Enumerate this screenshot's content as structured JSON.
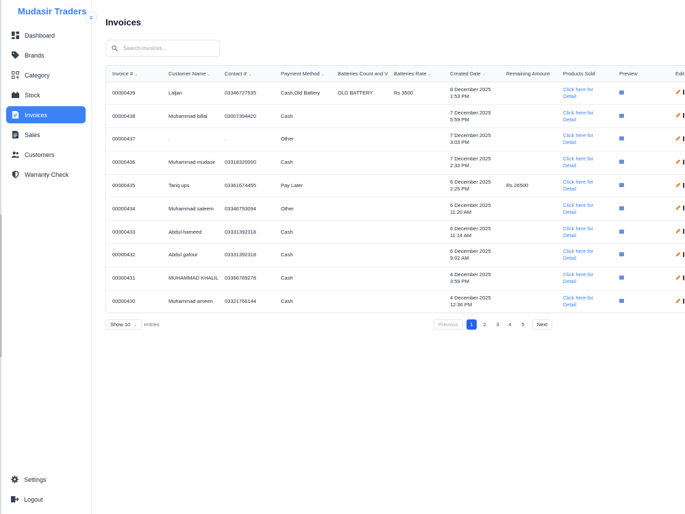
{
  "app": {
    "brand": "Mudasir Traders"
  },
  "sidebar": {
    "items": [
      {
        "label": "Dashboard",
        "icon": "dashboard-icon",
        "active": false
      },
      {
        "label": "Brands",
        "icon": "tag-icon",
        "active": false
      },
      {
        "label": "Category",
        "icon": "category-icon",
        "active": false
      },
      {
        "label": "Stock",
        "icon": "battery-icon",
        "active": false
      },
      {
        "label": "Invoices",
        "icon": "invoice-icon",
        "active": true
      },
      {
        "label": "Sales",
        "icon": "document-icon",
        "active": false
      },
      {
        "label": "Customers",
        "icon": "users-icon",
        "active": false
      },
      {
        "label": "Warranty Check",
        "icon": "shield-icon",
        "active": false
      }
    ],
    "bottom": [
      {
        "label": "Settings",
        "icon": "gear-icon"
      },
      {
        "label": "Logout",
        "icon": "logout-icon"
      }
    ],
    "collapse_icon": "collapse-sidebar-icon"
  },
  "main": {
    "title": "Invoices",
    "search": {
      "placeholder": "Search invoices...",
      "value": ""
    }
  },
  "table": {
    "columns": [
      {
        "label": "Invoice #",
        "sortable": true
      },
      {
        "label": "Customer Name",
        "sortable": true
      },
      {
        "label": "Contact #",
        "sortable": true
      },
      {
        "label": "Payment Method",
        "sortable": true
      },
      {
        "label": "Batteries Count and Ve",
        "sortable": false
      },
      {
        "label": "Batteries Rate",
        "sortable": true
      },
      {
        "label": "Created Date",
        "sortable": true
      },
      {
        "label": "Remaining Amount",
        "sortable": false
      },
      {
        "label": "Products Sold",
        "sortable": false
      },
      {
        "label": "Preview",
        "sortable": false
      },
      {
        "label": "Edit",
        "sortable": false
      }
    ],
    "rows": [
      {
        "invoice": "00000439",
        "customer": "Laljan",
        "contact": "03346727535",
        "payment": "Cash,Old Battery",
        "batteries_count": "OLD BATTERY",
        "rate": "Rs 3500",
        "date": "8 December 2025",
        "time": "1:53 PM",
        "remaining": "",
        "products_1": "Click here for",
        "products_2": "Detail"
      },
      {
        "invoice": "00000438",
        "customer": "Muhammad billal",
        "contact": "03007394420",
        "payment": "Cash",
        "batteries_count": "",
        "rate": "",
        "date": "7 December 2025",
        "time": "5:59 PM",
        "remaining": "",
        "products_1": "Click here for",
        "products_2": "Detail"
      },
      {
        "invoice": "00000437",
        "customer": ".",
        "contact": ".",
        "payment": "Other",
        "batteries_count": "",
        "rate": "",
        "date": "7 December 2025",
        "time": "3:03 PM",
        "remaining": "",
        "products_1": "Click here for",
        "products_2": "Detail"
      },
      {
        "invoice": "00000436",
        "customer": "Muhammad mudasir",
        "contact": "03318320000",
        "payment": "Cash",
        "batteries_count": "",
        "rate": "",
        "date": "7 December 2025",
        "time": "2:33 PM",
        "remaining": "",
        "products_1": "Click here for",
        "products_2": "Detail"
      },
      {
        "invoice": "00000435",
        "customer": "Tariq ups",
        "contact": "03361674455",
        "payment": "Pay Later",
        "batteries_count": "",
        "rate": "",
        "date": "6 December 2025",
        "time": "2:25 PM",
        "remaining": "Rs 26500",
        "products_1": "Click here for",
        "products_2": "Detail"
      },
      {
        "invoice": "00000434",
        "customer": "Muhammad saleem",
        "contact": "03346793094",
        "payment": "Other",
        "batteries_count": "",
        "rate": "",
        "date": "6 December 2025",
        "time": "11:20 AM",
        "remaining": "",
        "products_1": "Click here for",
        "products_2": "Detail"
      },
      {
        "invoice": "00000433",
        "customer": "Abdul hameed",
        "contact": "03331392318",
        "payment": "Cash",
        "batteries_count": "",
        "rate": "",
        "date": "6 December 2025",
        "time": "11:14 AM",
        "remaining": "",
        "products_1": "Click here for",
        "products_2": "Detail"
      },
      {
        "invoice": "00000432",
        "customer": "Abdul gafour",
        "contact": "03331392318",
        "payment": "Cash",
        "batteries_count": "",
        "rate": "",
        "date": "6 December 2025",
        "time": "9:02 AM",
        "remaining": "",
        "products_1": "Click here for",
        "products_2": "Detail"
      },
      {
        "invoice": "00000431",
        "customer": "MUHAMMAD KHALIL",
        "contact": "03366789278",
        "payment": "Cash",
        "batteries_count": "",
        "rate": "",
        "date": "4 December 2025",
        "time": "3:59 PM",
        "remaining": "",
        "products_1": "Click here for",
        "products_2": "Detail"
      },
      {
        "invoice": "00000430",
        "customer": "Muhammad ameen",
        "contact": "03321766144",
        "payment": "Cash",
        "batteries_count": "",
        "rate": "",
        "date": "4 December 2025",
        "time": "12:36 PM",
        "remaining": "",
        "products_1": "Click here for",
        "products_2": "Detail"
      }
    ]
  },
  "footer": {
    "show_label": "Show 10",
    "entries_label": "entries",
    "pagination": {
      "previous": "Previous",
      "next": "Next",
      "pages": [
        "1",
        "2",
        "3",
        "4",
        "5"
      ],
      "current": "1"
    }
  },
  "colors": {
    "accent": "#3b82f6",
    "active_page": "#2563eb",
    "edit": "#f97316"
  }
}
